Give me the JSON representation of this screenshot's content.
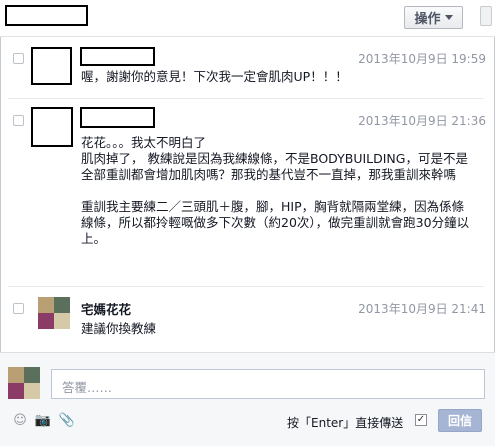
{
  "header": {
    "actions_label": "操作"
  },
  "messages": [
    {
      "timestamp": "2013年10月9日 19:59",
      "text": "喔，謝謝你的意見！下次我一定會肌肉UP！！！"
    },
    {
      "timestamp": "2013年10月9日 21:36",
      "text": "花花。。。我太不明白了\n肌肉掉了， 教練說是因為我練線條，不是BODYBUILDING，可是不是全部重訓都會增加肌肉嗎？那我的基代豈不一直掉，那我重訓來幹嗎\n\n重訓我主要練二／三頭肌＋腹，腳，HIP，胸背就隔兩堂練，因為係條線條，所以都拎輕嘅做多下次數（約20次），做完重訓就會跑30分鐘以上。"
    },
    {
      "sender": "宅媽花花",
      "timestamp": "2013年10月9日 21:41",
      "text": "建議你換教練"
    }
  ],
  "reply": {
    "placeholder": "答覆……",
    "enter_label": "按「Enter」直接傳送",
    "enter_checked_mark": "✓",
    "reply_button_label": "回信"
  },
  "icons": {
    "emoji": "☺",
    "camera": "📷",
    "attach": "📎"
  }
}
